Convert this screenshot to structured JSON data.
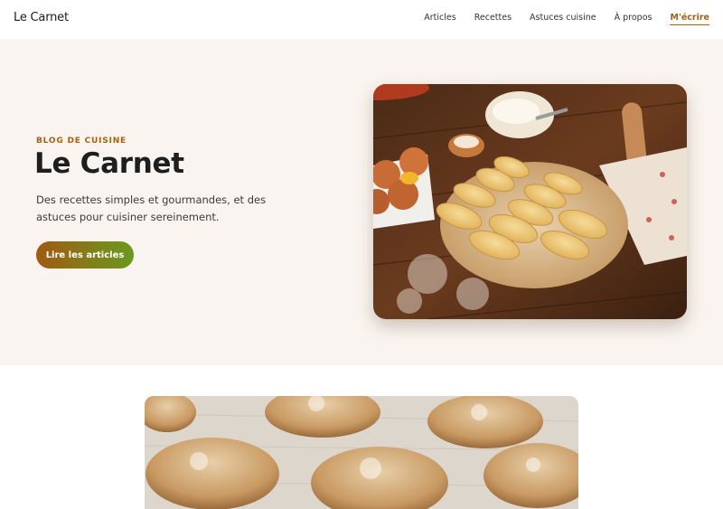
{
  "header": {
    "brand": "Le Carnet",
    "nav": [
      {
        "label": "Articles"
      },
      {
        "label": "Recettes"
      },
      {
        "label": "Astuces cuisine"
      },
      {
        "label": "À propos"
      },
      {
        "label": "M'écrire",
        "active": true
      }
    ]
  },
  "hero": {
    "eyebrow": "BLOG DE CUISINE",
    "title": "Le Carnet",
    "description": "Des recettes simples et gourmandes, et des astuces pour cuisiner sereinement.",
    "cta_label": "Lire les articles"
  },
  "colors": {
    "accent": "#a85f10",
    "hero_background": "#f9f4ef",
    "cta_gradient_start": "#a15a12",
    "cta_gradient_end": "#6a9a1e"
  },
  "images": {
    "hero_photo": "pastry-dough-on-wooden-table",
    "post_photo": "bread-rolls-on-floured-tray"
  }
}
